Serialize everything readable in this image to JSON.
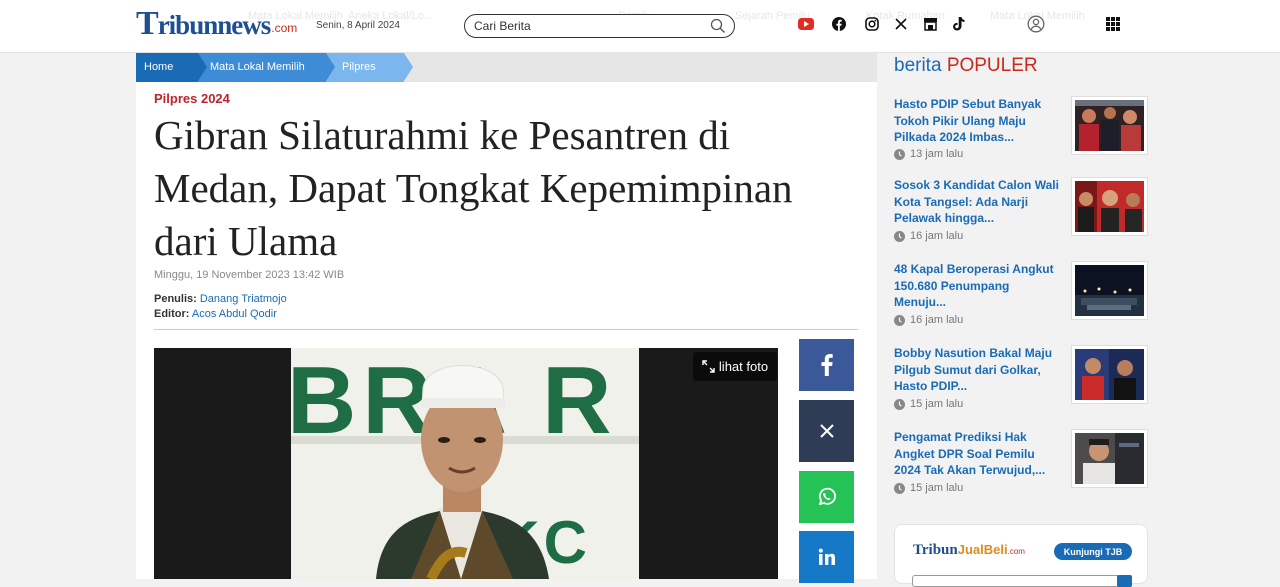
{
  "header": {
    "logo_prefix": "T",
    "logo_brand": "ribun",
    "logo_news": "news",
    "logo_suffix": ".com",
    "date": "Senin, 8 April 2024",
    "search": {
      "placeholder": "Cari Berita"
    },
    "social_icons": [
      "youtube-icon",
      "facebook-icon",
      "instagram-icon",
      "x-icon",
      "store-icon",
      "tiktok-icon"
    ],
    "ghost_nav": [
      "Mata Lokal Memilih",
      "Aneka Lokal/Lo...",
      "Pemilu",
      "Sejarah Pemilu",
      "Kotak Rumahan",
      "Mata Lokal Memilih"
    ]
  },
  "breadcrumb": [
    "Home",
    "Mata Lokal Memilih",
    "Pilpres"
  ],
  "article": {
    "kicker": "Pilpres 2024",
    "title": "Gibran Silaturahmi ke Pesantren di Medan, Dapat Tongkat Kepemimpinan dari Ulama",
    "published": "Minggu, 19 November 2023 13:42 WIB",
    "writer_label": "Penulis:",
    "writer": "Danang Triatmojo",
    "editor_label": "Editor:",
    "editor": "Acos Abdul Qodir",
    "photo_button": "lihat foto",
    "photo_banner_letters": "BRA R",
    "photo_banner_sub": "t LKC"
  },
  "share": [
    "facebook",
    "x",
    "whatsapp",
    "linkedin"
  ],
  "colors": {
    "brand_blue": "#1a6bb5",
    "brand_red": "#d0271c",
    "facebook": "#3b5998",
    "x": "#2e3d55",
    "whatsapp": "#25c255",
    "linkedin": "#1679c8"
  },
  "popular": {
    "title_a": "berita",
    "title_b": "POPULER",
    "items": [
      {
        "title": "Hasto PDIP Sebut Banyak Tokoh Pikir Ulang Maju Pilkada 2024 Imbas...",
        "time": "13 jam lalu"
      },
      {
        "title": "Sosok 3 Kandidat Calon Wali Kota Tangsel: Ada Narji Pelawak hingga...",
        "time": "16 jam lalu"
      },
      {
        "title": "48 Kapal Beroperasi Angkut 150.680 Penumpang Menuju...",
        "time": "16 jam lalu"
      },
      {
        "title": "Bobby Nasution Bakal Maju Pilgub Sumut dari Golkar, Hasto PDIP...",
        "time": "15 jam lalu"
      },
      {
        "title": "Pengamat Prediksi Hak Angket DPR Soal Pemilu 2024 Tak Akan Terwujud,...",
        "time": "15 jam lalu"
      }
    ]
  },
  "jualbeli": {
    "logo_a": "Tribun",
    "logo_b": "JualBeli",
    "logo_c": ".com",
    "button": "Kunjungi TJB"
  }
}
